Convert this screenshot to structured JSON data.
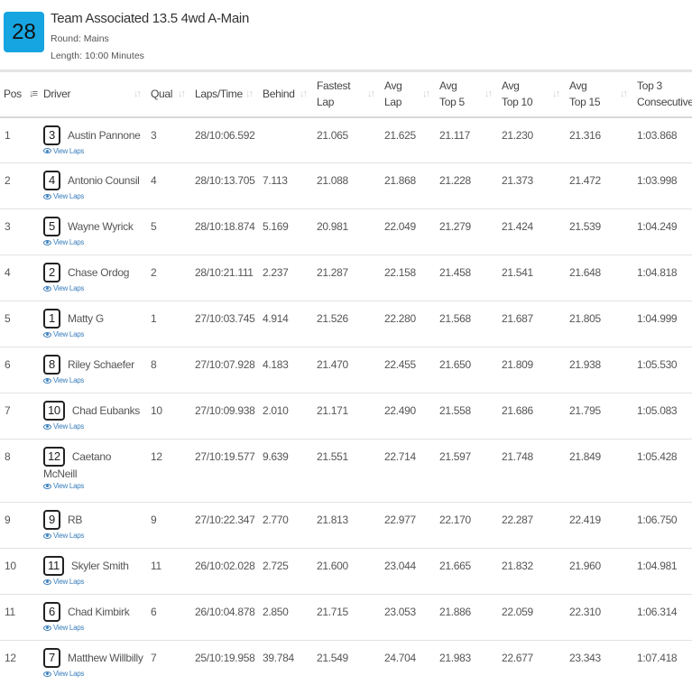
{
  "race": {
    "number": "28",
    "title": "Team Associated 13.5 4wd A-Main",
    "round": "Round: Mains",
    "length": "Length: 10:00 Minutes"
  },
  "columns": [
    {
      "label": "Pos",
      "sort": "active"
    },
    {
      "label": "Driver",
      "sort": "default"
    },
    {
      "label": "Qual",
      "sort": "default"
    },
    {
      "label": "Laps/Time",
      "sort": "default"
    },
    {
      "label": "Behind",
      "sort": "default"
    },
    {
      "label": "Fastest Lap",
      "sort": "default"
    },
    {
      "label": "Avg Lap",
      "sort": "default"
    },
    {
      "label": "Avg Top 5",
      "sort": "default"
    },
    {
      "label": "Avg Top 10",
      "sort": "default"
    },
    {
      "label": "Avg Top 15",
      "sort": "default"
    },
    {
      "label": "Top 3 Consecutive",
      "sort": "default"
    }
  ],
  "view_laps_label": "View Laps",
  "rows": [
    {
      "pos": "1",
      "car": "3",
      "driver": "Austin Pannone",
      "qual": "3",
      "laps_time": "28/10:06.592",
      "behind": "",
      "fastest": "21.065",
      "avg": "21.625",
      "top5": "21.117",
      "top10": "21.230",
      "top15": "21.316",
      "top3c": "1:03.868"
    },
    {
      "pos": "2",
      "car": "4",
      "driver": "Antonio Counsil",
      "qual": "4",
      "laps_time": "28/10:13.705",
      "behind": "7.113",
      "fastest": "21.088",
      "avg": "21.868",
      "top5": "21.228",
      "top10": "21.373",
      "top15": "21.472",
      "top3c": "1:03.998"
    },
    {
      "pos": "3",
      "car": "5",
      "driver": "Wayne Wyrick",
      "qual": "5",
      "laps_time": "28/10:18.874",
      "behind": "5.169",
      "fastest": "20.981",
      "avg": "22.049",
      "top5": "21.279",
      "top10": "21.424",
      "top15": "21.539",
      "top3c": "1:04.249"
    },
    {
      "pos": "4",
      "car": "2",
      "driver": "Chase Ordog",
      "qual": "2",
      "laps_time": "28/10:21.111",
      "behind": "2.237",
      "fastest": "21.287",
      "avg": "22.158",
      "top5": "21.458",
      "top10": "21.541",
      "top15": "21.648",
      "top3c": "1:04.818"
    },
    {
      "pos": "5",
      "car": "1",
      "driver": "Matty G",
      "qual": "1",
      "laps_time": "27/10:03.745",
      "behind": "4.914",
      "fastest": "21.526",
      "avg": "22.280",
      "top5": "21.568",
      "top10": "21.687",
      "top15": "21.805",
      "top3c": "1:04.999"
    },
    {
      "pos": "6",
      "car": "8",
      "driver": "Riley Schaefer",
      "qual": "8",
      "laps_time": "27/10:07.928",
      "behind": "4.183",
      "fastest": "21.470",
      "avg": "22.455",
      "top5": "21.650",
      "top10": "21.809",
      "top15": "21.938",
      "top3c": "1:05.530"
    },
    {
      "pos": "7",
      "car": "10",
      "driver": "Chad Eubanks",
      "qual": "10",
      "laps_time": "27/10:09.938",
      "behind": "2.010",
      "fastest": "21.171",
      "avg": "22.490",
      "top5": "21.558",
      "top10": "21.686",
      "top15": "21.795",
      "top3c": "1:05.083"
    },
    {
      "pos": "8",
      "car": "12",
      "driver": "Caetano McNeill",
      "qual": "12",
      "laps_time": "27/10:19.577",
      "behind": "9.639",
      "fastest": "21.551",
      "avg": "22.714",
      "top5": "21.597",
      "top10": "21.748",
      "top15": "21.849",
      "top3c": "1:05.428"
    },
    {
      "pos": "9",
      "car": "9",
      "driver": "RB",
      "qual": "9",
      "laps_time": "27/10:22.347",
      "behind": "2.770",
      "fastest": "21.813",
      "avg": "22.977",
      "top5": "22.170",
      "top10": "22.287",
      "top15": "22.419",
      "top3c": "1:06.750"
    },
    {
      "pos": "10",
      "car": "11",
      "driver": "Skyler Smith",
      "qual": "11",
      "laps_time": "26/10:02.028",
      "behind": "2.725",
      "fastest": "21.600",
      "avg": "23.044",
      "top5": "21.665",
      "top10": "21.832",
      "top15": "21.960",
      "top3c": "1:04.981"
    },
    {
      "pos": "11",
      "car": "6",
      "driver": "Chad Kimbirk",
      "qual": "6",
      "laps_time": "26/10:04.878",
      "behind": "2.850",
      "fastest": "21.715",
      "avg": "23.053",
      "top5": "21.886",
      "top10": "22.059",
      "top15": "22.310",
      "top3c": "1:06.314"
    },
    {
      "pos": "12",
      "car": "7",
      "driver": "Matthew Willbilly",
      "qual": "7",
      "laps_time": "25/10:19.958",
      "behind": "39.784",
      "fastest": "21.549",
      "avg": "24.704",
      "top5": "21.983",
      "top10": "22.677",
      "top15": "23.343",
      "top3c": "1:07.418"
    }
  ]
}
